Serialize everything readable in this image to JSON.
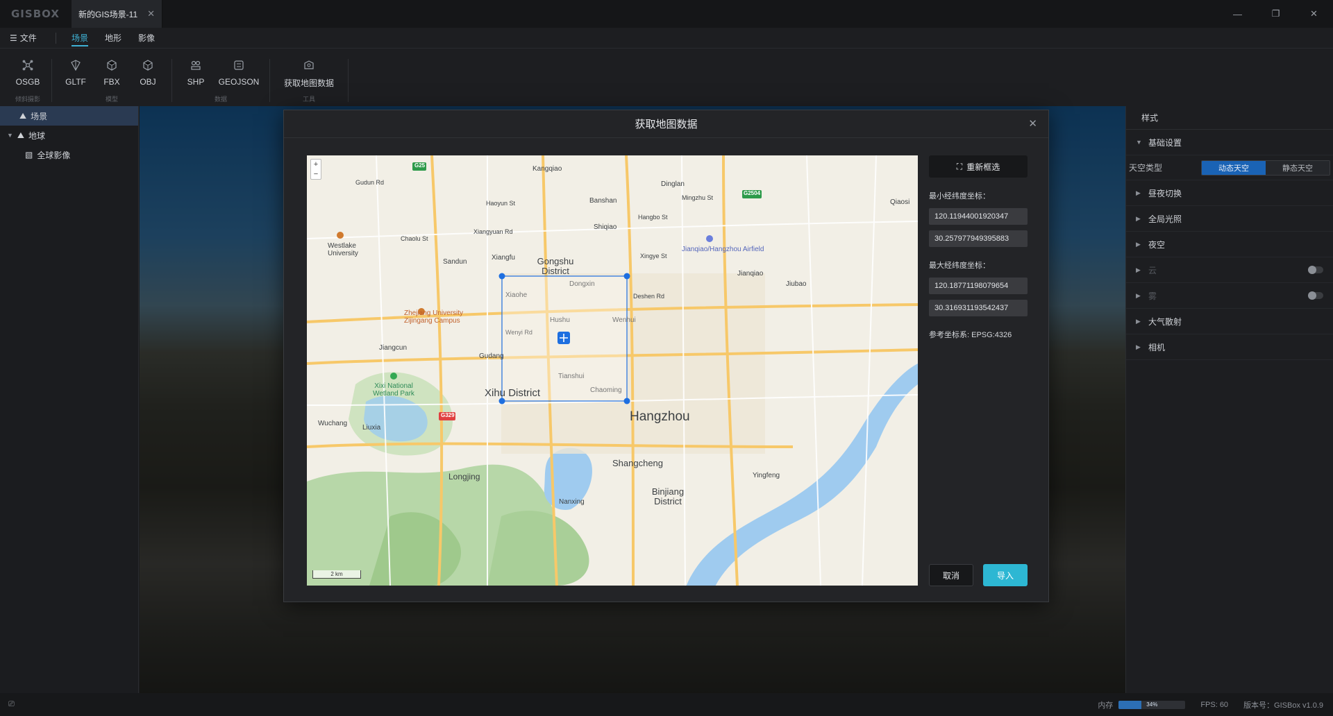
{
  "app": {
    "brand": "GISBOX",
    "doc_tab": "新的GIS场景-11",
    "window_controls": [
      "minimize-icon",
      "restore-icon",
      "close-icon"
    ]
  },
  "menu": {
    "file": "文件",
    "tabs": [
      "场景",
      "地形",
      "影像"
    ],
    "active_tab": "场景"
  },
  "toolbar": {
    "groups": [
      {
        "label": "倾斜摄影",
        "items": [
          {
            "label": "OSGB",
            "icon": "osgb-icon"
          }
        ]
      },
      {
        "label": "模型",
        "items": [
          {
            "label": "GLTF",
            "icon": "gltf-icon"
          },
          {
            "label": "FBX",
            "icon": "fbx-icon"
          },
          {
            "label": "OBJ",
            "icon": "obj-icon"
          }
        ]
      },
      {
        "label": "数据",
        "items": [
          {
            "label": "SHP",
            "icon": "shp-icon"
          },
          {
            "label": "GEOJSON",
            "icon": "geojson-icon"
          }
        ]
      },
      {
        "label": "工具",
        "items": [
          {
            "label": "获取地图数据",
            "icon": "map-data-icon"
          }
        ]
      }
    ]
  },
  "tree": {
    "items": [
      {
        "label": "场景",
        "level": 0,
        "selected": true
      },
      {
        "label": "地球",
        "level": 0,
        "expanded": true
      },
      {
        "label": "全球影像",
        "level": 1
      }
    ]
  },
  "dialog": {
    "title": "获取地图数据",
    "reselect": "重新框选",
    "min_label": "最小经纬度坐标：",
    "min_lon": "120.11944001920347",
    "min_lat": "30.257977949395883",
    "max_label": "最大经纬度坐标：",
    "max_lon": "120.18771198079654",
    "max_lat": "30.316931193542437",
    "crs": "参考坐标系: EPSG:4326",
    "cancel": "取消",
    "import": "导入",
    "map": {
      "zoom_in": "+",
      "zoom_out": "−",
      "scale": "2 km",
      "labels": [
        "Kangqiao",
        "Dinglan",
        "Gudun Rd",
        "Banshan",
        "Haoyun St",
        "Mingzhu St",
        "Qiaosi",
        "Hangbo St",
        "Shiqiao",
        "Xiangyuan Rd",
        "Chaolu St",
        "Westlake University",
        "Sandun",
        "Xiangfu",
        "Gongshu District",
        "Xingye St",
        "Jianqiao/Hangzhou Airfield",
        "Jianqiao",
        "Dongxin",
        "Jiubao",
        "Xiaohe",
        "Deshen Rd",
        "Zhejiang University Zijingang Campus",
        "Hushu",
        "Wenhui",
        "Wenyi Rd",
        "Jiangcun",
        "Gudang",
        "Tianshui",
        "Xihu District",
        "Chaoming",
        "Xixi National Wetland Park",
        "Hangzhou",
        "Wuchang",
        "Liuxia",
        "Longjing",
        "Shangcheng",
        "Yingfeng",
        "Binjiang District",
        "Nanxing",
        "G25",
        "G2504",
        "G329"
      ]
    }
  },
  "right_panel": {
    "tab": "样式",
    "sections": [
      {
        "label": "基础设置",
        "expanded": true
      },
      {
        "label": "昼夜切换"
      },
      {
        "label": "全局光照"
      },
      {
        "label": "夜空"
      },
      {
        "label": "云",
        "disabled": true,
        "toggle": false
      },
      {
        "label": "雾",
        "disabled": true,
        "toggle": false
      },
      {
        "label": "大气散射"
      },
      {
        "label": "相机"
      }
    ],
    "sky_type_label": "天空类型",
    "sky_options": [
      "动态天空",
      "静态天空"
    ],
    "sky_selected": "动态天空"
  },
  "status": {
    "memory_label": "内存",
    "memory_value": "34%",
    "memory_fraction": 0.34,
    "fps": "FPS: 60",
    "version": "版本号：GISBox v1.0.9"
  },
  "colors": {
    "accent": "#3fb3d6",
    "selection": "#1a63b5",
    "import_button": "#2db7d3",
    "map_bbox": "#1e6fe0"
  }
}
